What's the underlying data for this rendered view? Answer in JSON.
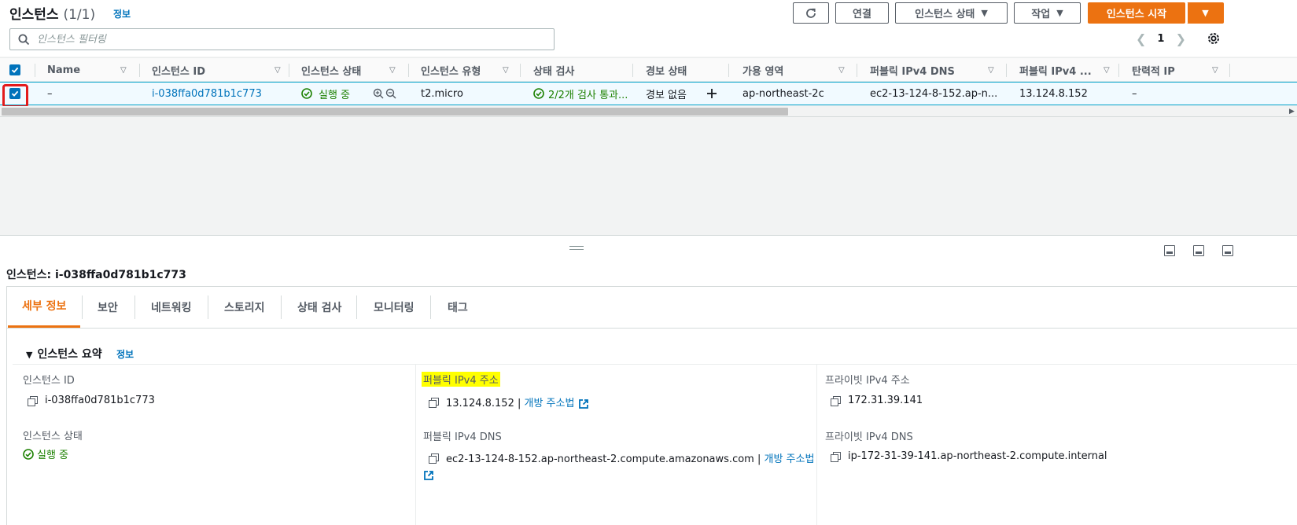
{
  "header": {
    "title": "인스턴스",
    "count": "(1/1)",
    "info": "정보",
    "buttons": {
      "connect": "연결",
      "instance_state": "인스턴스 상태",
      "actions": "작업",
      "launch": "인스턴스 시작"
    }
  },
  "filter": {
    "placeholder": "인스턴스 필터링",
    "page": "1"
  },
  "table": {
    "columns": [
      "Name",
      "인스턴스 ID",
      "인스턴스 상태",
      "인스턴스 유형",
      "상태 검사",
      "경보 상태",
      "가용 영역",
      "퍼블릭 IPv4 DNS",
      "퍼블릭 IPv4 ...",
      "탄력적 IP"
    ],
    "row": {
      "name": "–",
      "instance_id": "i-038ffa0d781b1c773",
      "state": "실행 중",
      "type": "t2.micro",
      "status_check": "2/2개 검사 통과...",
      "alarm": "경보 없음",
      "az": "ap-northeast-2c",
      "public_dns": "ec2-13-124-8-152.ap-n...",
      "public_ip": "13.124.8.152",
      "elastic_ip": "–"
    }
  },
  "detail": {
    "title": "인스턴스: i-038ffa0d781b1c773",
    "tabs": [
      "세부 정보",
      "보안",
      "네트워킹",
      "스토리지",
      "상태 검사",
      "모니터링",
      "태그"
    ],
    "section": "인스턴스 요약",
    "section_info": "정보",
    "fields": {
      "instance_id_label": "인스턴스 ID",
      "instance_id_value": "i-038ffa0d781b1c773",
      "state_label": "인스턴스 상태",
      "state_value": "실행 중",
      "public_ip_label": "퍼블릭 IPv4 주소",
      "public_ip_value": "13.124.8.152 |",
      "open_address": "개방 주소법",
      "public_dns_label": "퍼블릭 IPv4 DNS",
      "public_dns_value": "ec2-13-124-8-152.ap-northeast-2.compute.amazonaws.com |",
      "open_address_2": "개방 주소법",
      "private_ip_label": "프라이빗 IPv4 주소",
      "private_ip_value": "172.31.39.141",
      "private_dns_label": "프라이빗 IPv4 DNS",
      "private_dns_value": "ip-172-31-39-141.ap-northeast-2.compute.internal"
    }
  },
  "colors": {
    "accent": "#ec7211",
    "link": "#0073bb",
    "success": "#1d8102",
    "selection": "#f1faff",
    "highlight": "#ffff00",
    "annotation": "#e31b1b"
  }
}
